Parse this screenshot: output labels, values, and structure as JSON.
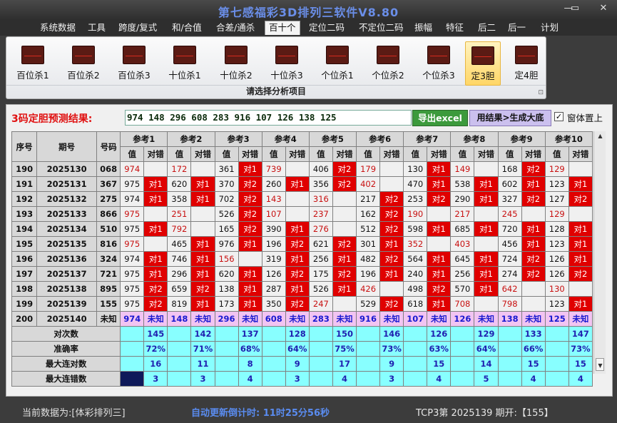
{
  "window": {
    "title": "第七感福彩3D排列三软件V8.80",
    "minimize": "—",
    "restore": "▭",
    "close": "✕"
  },
  "menu": [
    "系统数据",
    "工具",
    "跨度/复式",
    "和/合值",
    "合差/通杀",
    "百十个",
    "定位二码",
    "不定位二码",
    "振幅",
    "特征",
    "后二",
    "后一",
    "计划"
  ],
  "menu_active": "百十个",
  "ribbon": {
    "buttons": [
      "百位杀1",
      "百位杀2",
      "百位杀3",
      "十位杀1",
      "十位杀2",
      "十位杀3",
      "个位杀1",
      "个位杀2",
      "个位杀3",
      "定3胆",
      "定4胆"
    ],
    "selected": "定3胆",
    "icon": "chart-icon",
    "caption": "请选择分析项目",
    "caption_icon": "⊡"
  },
  "result": {
    "label": "3码定胆预测结果:",
    "value": "974 148 296 608 283 916 107 126 138 125",
    "export_label": "导出excel",
    "generate_label": "用结果>生成大底",
    "pin_label": "窗体置上",
    "pin_checked": "✓"
  },
  "table": {
    "fixed_headers": [
      "序号",
      "期号",
      "号码"
    ],
    "groups": [
      "参考1",
      "参考2",
      "参考3",
      "参考4",
      "参考5",
      "参考6",
      "参考7",
      "参考8",
      "参考9",
      "参考10"
    ],
    "sub_headers": [
      "值",
      "对错"
    ],
    "rows": [
      {
        "seq": "190",
        "period": "2025130",
        "num": "068",
        "cells": [
          [
            "974",
            ""
          ],
          [
            "172",
            ""
          ],
          [
            "361",
            "对1"
          ],
          [
            "739",
            ""
          ],
          [
            "406",
            "对2"
          ],
          [
            "179",
            ""
          ],
          [
            "130",
            "对1"
          ],
          [
            "149",
            ""
          ],
          [
            "168",
            "对2"
          ],
          [
            "129",
            ""
          ]
        ]
      },
      {
        "seq": "191",
        "period": "2025131",
        "num": "367",
        "cells": [
          [
            "975",
            "对1"
          ],
          [
            "620",
            "对1"
          ],
          [
            "370",
            "对2"
          ],
          [
            "260",
            "对1"
          ],
          [
            "356",
            "对2"
          ],
          [
            "402",
            ""
          ],
          [
            "470",
            "对1"
          ],
          [
            "538",
            "对1"
          ],
          [
            "602",
            "对1"
          ],
          [
            "123",
            "对1"
          ]
        ]
      },
      {
        "seq": "192",
        "period": "2025132",
        "num": "275",
        "cells": [
          [
            "974",
            "对1"
          ],
          [
            "358",
            "对1"
          ],
          [
            "702",
            "对2"
          ],
          [
            "143",
            ""
          ],
          [
            "316",
            ""
          ],
          [
            "217",
            "对2"
          ],
          [
            "253",
            "对2"
          ],
          [
            "290",
            "对1"
          ],
          [
            "327",
            "对2"
          ],
          [
            "127",
            "对2"
          ]
        ]
      },
      {
        "seq": "193",
        "period": "2025133",
        "num": "866",
        "cells": [
          [
            "975",
            ""
          ],
          [
            "251",
            ""
          ],
          [
            "526",
            "对2"
          ],
          [
            "107",
            ""
          ],
          [
            "237",
            ""
          ],
          [
            "162",
            "对2"
          ],
          [
            "190",
            ""
          ],
          [
            "217",
            ""
          ],
          [
            "245",
            ""
          ],
          [
            "129",
            ""
          ]
        ]
      },
      {
        "seq": "194",
        "period": "2025134",
        "num": "510",
        "cells": [
          [
            "975",
            "对1"
          ],
          [
            "792",
            ""
          ],
          [
            "165",
            "对2"
          ],
          [
            "390",
            "对1"
          ],
          [
            "276",
            ""
          ],
          [
            "512",
            "对2"
          ],
          [
            "598",
            "对1"
          ],
          [
            "685",
            "对1"
          ],
          [
            "720",
            "对1"
          ],
          [
            "128",
            "对1"
          ]
        ]
      },
      {
        "seq": "195",
        "period": "2025135",
        "num": "816",
        "cells": [
          [
            "975",
            ""
          ],
          [
            "465",
            "对1"
          ],
          [
            "976",
            "对1"
          ],
          [
            "196",
            "对2"
          ],
          [
            "621",
            "对2"
          ],
          [
            "301",
            "对1"
          ],
          [
            "352",
            ""
          ],
          [
            "403",
            ""
          ],
          [
            "456",
            "对1"
          ],
          [
            "123",
            "对1"
          ]
        ]
      },
      {
        "seq": "196",
        "period": "2025136",
        "num": "324",
        "cells": [
          [
            "974",
            "对1"
          ],
          [
            "746",
            "对1"
          ],
          [
            "156",
            ""
          ],
          [
            "319",
            "对1"
          ],
          [
            "256",
            "对1"
          ],
          [
            "482",
            "对2"
          ],
          [
            "564",
            "对1"
          ],
          [
            "645",
            "对1"
          ],
          [
            "724",
            "对2"
          ],
          [
            "126",
            "对1"
          ]
        ]
      },
      {
        "seq": "197",
        "period": "2025137",
        "num": "721",
        "cells": [
          [
            "975",
            "对1"
          ],
          [
            "296",
            "对1"
          ],
          [
            "620",
            "对1"
          ],
          [
            "126",
            "对2"
          ],
          [
            "175",
            "对2"
          ],
          [
            "196",
            "对1"
          ],
          [
            "240",
            "对1"
          ],
          [
            "256",
            "对1"
          ],
          [
            "274",
            "对2"
          ],
          [
            "126",
            "对2"
          ]
        ]
      },
      {
        "seq": "198",
        "period": "2025138",
        "num": "895",
        "cells": [
          [
            "975",
            "对2"
          ],
          [
            "659",
            "对2"
          ],
          [
            "138",
            "对1"
          ],
          [
            "287",
            "对1"
          ],
          [
            "526",
            "对1"
          ],
          [
            "426",
            ""
          ],
          [
            "498",
            "对2"
          ],
          [
            "570",
            "对1"
          ],
          [
            "642",
            ""
          ],
          [
            "130",
            ""
          ]
        ]
      },
      {
        "seq": "199",
        "period": "2025139",
        "num": "155",
        "cells": [
          [
            "975",
            "对2"
          ],
          [
            "819",
            "对1"
          ],
          [
            "173",
            "对1"
          ],
          [
            "350",
            "对2"
          ],
          [
            "247",
            ""
          ],
          [
            "529",
            "对2"
          ],
          [
            "618",
            "对1"
          ],
          [
            "708",
            ""
          ],
          [
            "798",
            ""
          ],
          [
            "123",
            "对1"
          ]
        ]
      }
    ],
    "pending": {
      "seq": "200",
      "period": "2025140",
      "num": "未知",
      "cells": [
        [
          "974",
          "未知"
        ],
        [
          "148",
          "未知"
        ],
        [
          "296",
          "未知"
        ],
        [
          "608",
          "未知"
        ],
        [
          "283",
          "未知"
        ],
        [
          "916",
          "未知"
        ],
        [
          "107",
          "未知"
        ],
        [
          "126",
          "未知"
        ],
        [
          "138",
          "未知"
        ],
        [
          "125",
          "未知"
        ]
      ]
    },
    "stats": [
      {
        "label": "对次数",
        "values": [
          "145",
          "142",
          "137",
          "128",
          "150",
          "146",
          "126",
          "129",
          "133",
          "147"
        ]
      },
      {
        "label": "准确率",
        "values": [
          "72%",
          "71%",
          "68%",
          "64%",
          "75%",
          "73%",
          "63%",
          "64%",
          "66%",
          "73%"
        ]
      },
      {
        "label": "最大连对数",
        "values": [
          "16",
          "11",
          "8",
          "9",
          "17",
          "9",
          "15",
          "14",
          "15",
          "15"
        ]
      },
      {
        "label": "最大连错数",
        "values": [
          "3",
          "3",
          "4",
          "3",
          "4",
          "3",
          "4",
          "5",
          "4",
          "4"
        ]
      }
    ]
  },
  "status": {
    "current": "当前数据为:[体彩排列三]",
    "countdown": "自动更新倒计时: 11时25分56秒",
    "period": "TCP3第 2025139 期开:【155】"
  },
  "colors": {
    "hit": "#e00000",
    "pending": "#f2c4f2",
    "stats": "#88ffff",
    "accent": "#6a8ee8"
  }
}
